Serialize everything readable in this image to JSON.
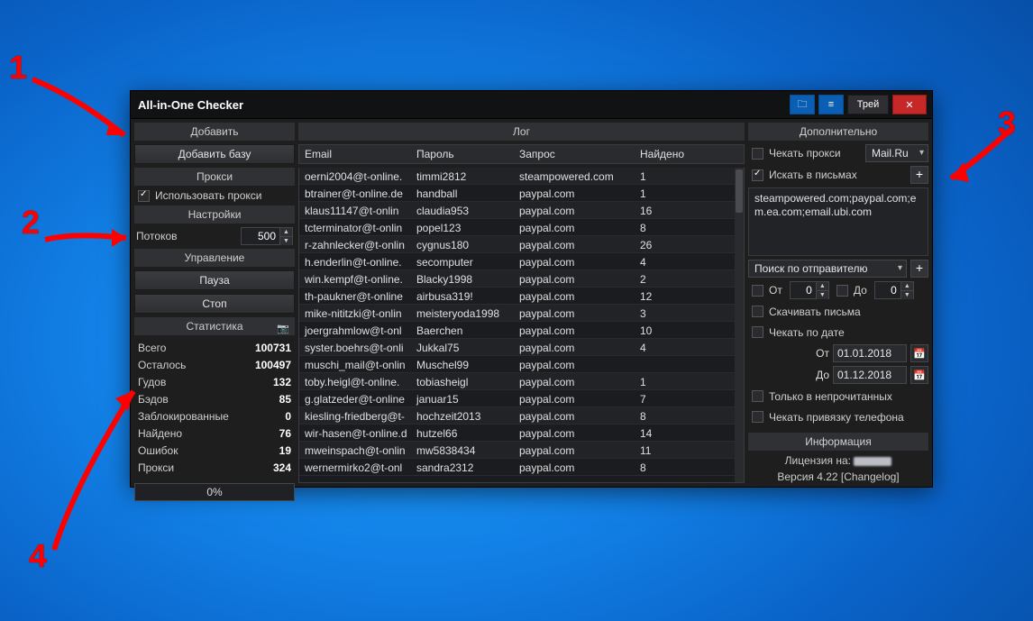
{
  "annotations": {
    "n1": "1",
    "n2": "2",
    "n3": "3",
    "n4": "4"
  },
  "titlebar": {
    "title": "All-in-One Checker",
    "tray": "Трей"
  },
  "left": {
    "add_header": "Добавить",
    "add_base": "Добавить базу",
    "proxy_header": "Прокси",
    "use_proxy": "Использовать прокси",
    "settings_header": "Настройки",
    "threads_label": "Потоков",
    "threads_value": "500",
    "control_header": "Управление",
    "pause": "Пауза",
    "stop": "Стоп",
    "stats_header": "Статистика",
    "stats": [
      {
        "k": "Всего",
        "v": "100731"
      },
      {
        "k": "Осталось",
        "v": "100497"
      },
      {
        "k": "Гудов",
        "v": "132"
      },
      {
        "k": "Бэдов",
        "v": "85"
      },
      {
        "k": "Заблокированные",
        "v": "0"
      },
      {
        "k": "Найдено",
        "v": "76"
      },
      {
        "k": "Ошибок",
        "v": "19"
      },
      {
        "k": "Прокси",
        "v": "324"
      }
    ],
    "progress": "0%"
  },
  "log": {
    "header": "Лог",
    "cols": {
      "email": "Email",
      "pass": "Пароль",
      "req": "Запрос",
      "found": "Найдено"
    },
    "rows": [
      {
        "email": "oerni2004@t-online.",
        "pass": "timmi2812",
        "req": "steampowered.com",
        "found": "1"
      },
      {
        "email": "btrainer@t-online.de",
        "pass": "handball",
        "req": "paypal.com",
        "found": "1"
      },
      {
        "email": "klaus11147@t-onlin",
        "pass": "claudia953",
        "req": "paypal.com",
        "found": "16"
      },
      {
        "email": "tcterminator@t-onlin",
        "pass": "popel123",
        "req": "paypal.com",
        "found": "8"
      },
      {
        "email": "r-zahnlecker@t-onlin",
        "pass": "cygnus180",
        "req": "paypal.com",
        "found": "26"
      },
      {
        "email": "h.enderlin@t-online.",
        "pass": "secomputer",
        "req": "paypal.com",
        "found": "4"
      },
      {
        "email": "win.kempf@t-online.",
        "pass": "Blacky1998",
        "req": "paypal.com",
        "found": "2"
      },
      {
        "email": "th-paukner@t-online",
        "pass": "airbusa319!",
        "req": "paypal.com",
        "found": "12"
      },
      {
        "email": "mike-nititzki@t-onlin",
        "pass": "meisteryoda1998",
        "req": "paypal.com",
        "found": "3"
      },
      {
        "email": "joergrahmlow@t-onl",
        "pass": "Baerchen",
        "req": "paypal.com",
        "found": "10"
      },
      {
        "email": "syster.boehrs@t-onli",
        "pass": "Jukkal75",
        "req": "paypal.com",
        "found": "4"
      },
      {
        "email": "muschi_mail@t-onlin",
        "pass": "Muschel99",
        "req": "paypal.com",
        "found": ""
      },
      {
        "email": "toby.heigl@t-online.",
        "pass": "tobiasheigl",
        "req": "paypal.com",
        "found": "1"
      },
      {
        "email": "g.glatzeder@t-online",
        "pass": "januar15",
        "req": "paypal.com",
        "found": "7"
      },
      {
        "email": "kiesling-friedberg@t-",
        "pass": "hochzeit2013",
        "req": "paypal.com",
        "found": "8"
      },
      {
        "email": "wir-hasen@t-online.d",
        "pass": "hutzel66",
        "req": "paypal.com",
        "found": "14"
      },
      {
        "email": "mweinspach@t-onlin",
        "pass": "mw5838434",
        "req": "paypal.com",
        "found": "11"
      },
      {
        "email": "wernermirko2@t-onl",
        "pass": "sandra2312",
        "req": "paypal.com",
        "found": "8"
      }
    ]
  },
  "right": {
    "header": "Дополнительно",
    "check_proxy": "Чекать прокси",
    "mailru": "Mail.Ru",
    "search_letters": "Искать в письмах",
    "domains": "steampowered.com;paypal.com;em.ea.com;email.ubi.com",
    "search_sender": "Поиск по отправителю",
    "from_lbl": "От",
    "from_val": "0",
    "to_lbl": "До",
    "to_val": "0",
    "download_letters": "Скачивать письма",
    "check_date": "Чекать по дате",
    "date_from_lbl": "От",
    "date_from": "01.01.2018",
    "date_to_lbl": "До",
    "date_to": "01.12.2018",
    "only_unread": "Только в непрочитанных",
    "check_phone": "Чекать привязку телефона",
    "info_header": "Информация",
    "license": "Лицензия на:",
    "version": "Версия 4.22 [Changelog]"
  }
}
